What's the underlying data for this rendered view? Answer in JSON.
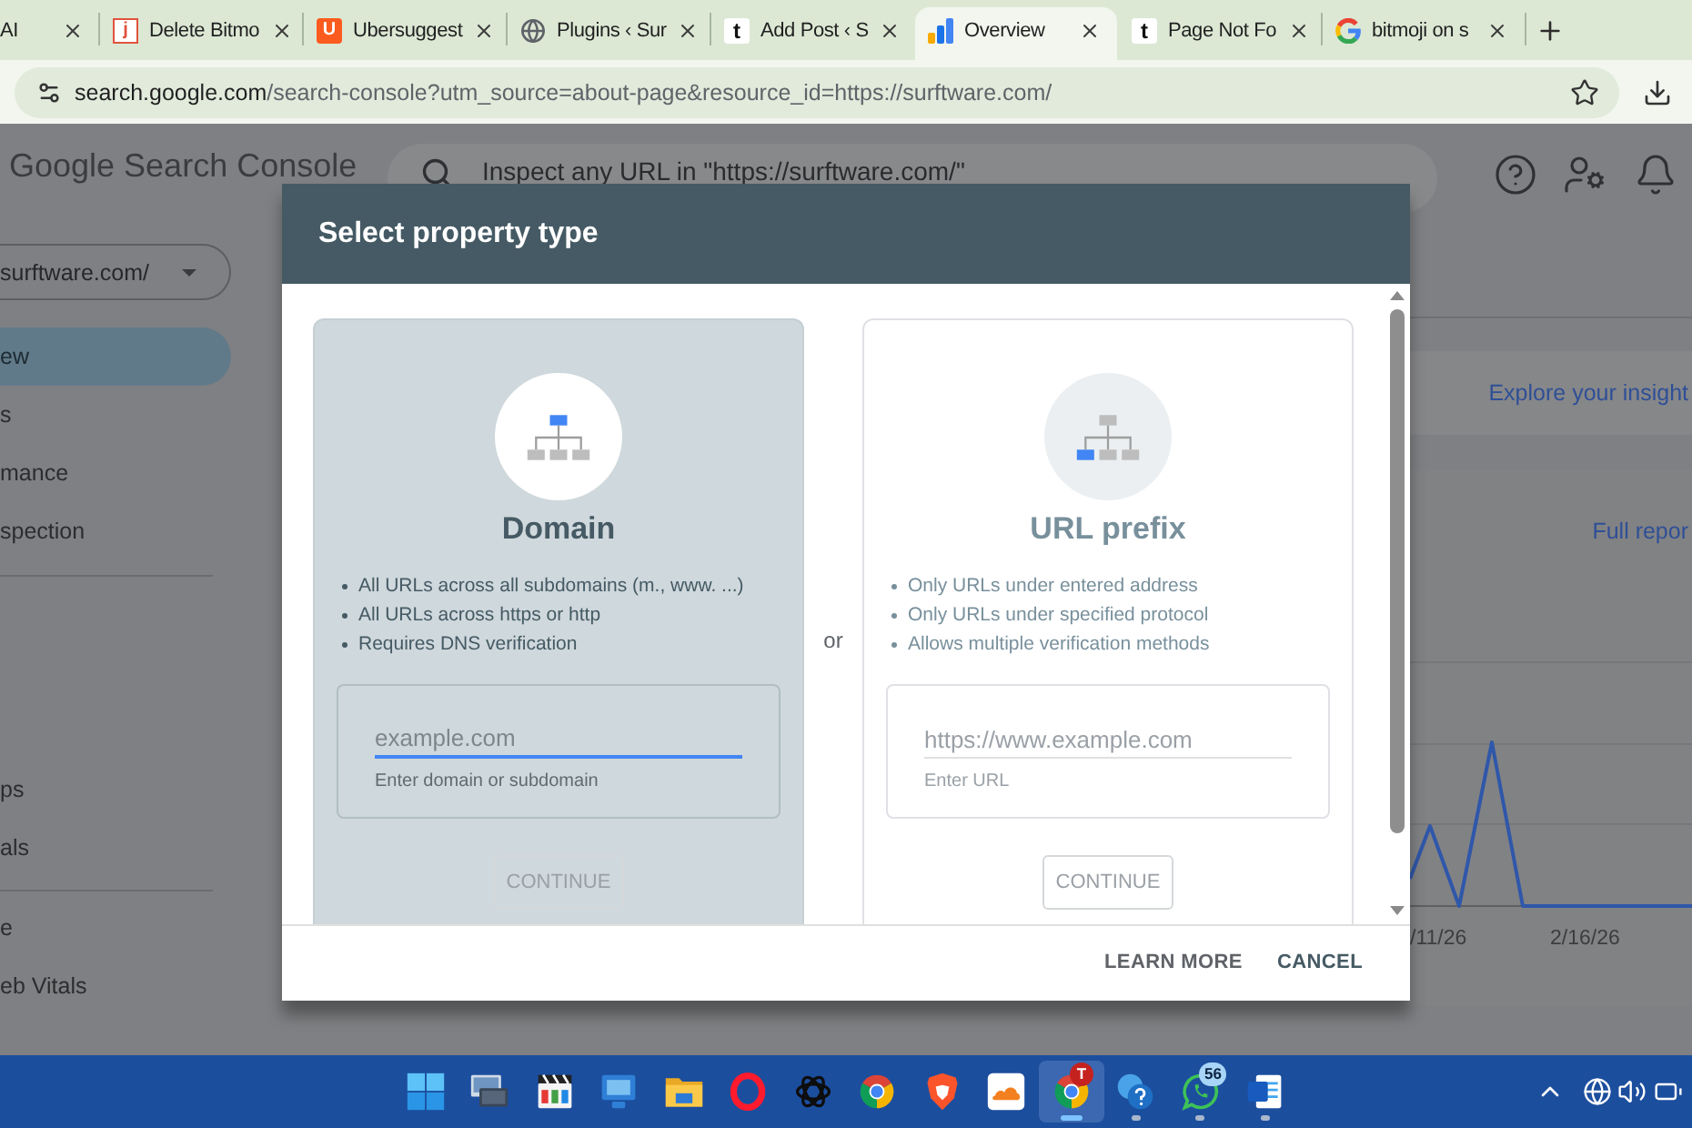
{
  "browser": {
    "tabs": [
      {
        "title": "AI",
        "selected": false
      },
      {
        "title": "Delete Bitmo",
        "selected": false,
        "favicon": {
          "kind": "outline-letter",
          "text": "j"
        }
      },
      {
        "title": "Ubersuggest",
        "selected": false,
        "favicon": {
          "kind": "filled-letter",
          "text": "U"
        }
      },
      {
        "title": "Plugins ‹ Sur",
        "selected": false,
        "favicon": {
          "kind": "globe"
        }
      },
      {
        "title": "Add Post ‹ S",
        "selected": false,
        "favicon": {
          "kind": "letter",
          "text": "t"
        }
      },
      {
        "title": "Overview",
        "selected": true,
        "favicon": {
          "kind": "analytics"
        }
      },
      {
        "title": "Page Not Fo",
        "selected": false,
        "favicon": {
          "kind": "letter",
          "text": "t"
        }
      },
      {
        "title": "bitmoji on s",
        "selected": false,
        "favicon": {
          "kind": "google"
        }
      }
    ],
    "address": {
      "host": "search.google.com",
      "path": "/search-console?utm_source=about-page&resource_id=https://surftware.com/"
    }
  },
  "header": {
    "product": "Google Search Console",
    "search": {
      "placeholder": "Inspect any URL in \"https://surftware.com/\""
    }
  },
  "sidebar": {
    "property": "surftware.com/",
    "groups": [
      {
        "items": [
          {
            "label": "ew",
            "selected": true
          },
          {
            "label": "s",
            "selected": false
          },
          {
            "label": "mance",
            "selected": false
          },
          {
            "label": "spection",
            "selected": false
          }
        ]
      },
      {
        "items": [
          {
            "label": "ps",
            "selected": false
          },
          {
            "label": "als",
            "selected": false
          }
        ]
      },
      {
        "items": [
          {
            "label": "e",
            "selected": false
          },
          {
            "label": "eb Vitals",
            "selected": false
          }
        ]
      }
    ]
  },
  "main": {
    "insights_link": "Explore your insight",
    "report_link": "Full repor",
    "chart": {
      "x_labels": [
        "/11/26",
        "2/16/26"
      ]
    }
  },
  "dialog": {
    "title": "Select property type",
    "options": [
      {
        "kind": "domain",
        "selected": true,
        "title": "Domain",
        "bullets": [
          "All URLs across all subdomains (m., www. ...)",
          "All URLs across https or http",
          "Requires DNS verification"
        ],
        "input": {
          "placeholder": "example.com",
          "helper": "Enter domain or subdomain"
        },
        "button": {
          "label": "CONTINUE",
          "disabled": true
        }
      },
      {
        "kind": "url-prefix",
        "selected": false,
        "title": "URL prefix",
        "bullets": [
          "Only URLs under entered address",
          "Only URLs under specified protocol",
          "Allows multiple verification methods"
        ],
        "input": {
          "placeholder": "https://www.example.com",
          "helper": "Enter URL"
        },
        "button": {
          "label": "CONTINUE",
          "disabled": true
        }
      }
    ],
    "separator": "or",
    "actions": [
      {
        "label": "LEARN MORE",
        "kind": "secondary"
      },
      {
        "label": "CANCEL",
        "kind": "primary"
      }
    ]
  },
  "taskbar": {
    "apps": [
      {
        "kind": "start",
        "running": false,
        "active": false
      },
      {
        "kind": "monitor",
        "running": false,
        "active": false
      },
      {
        "kind": "clapperboard",
        "running": false,
        "active": false
      },
      {
        "kind": "display",
        "running": false,
        "active": false
      },
      {
        "kind": "folder",
        "running": false,
        "active": false
      },
      {
        "kind": "ring",
        "running": false,
        "active": false
      },
      {
        "kind": "knot",
        "running": false,
        "active": false
      },
      {
        "kind": "browser",
        "running": false,
        "active": false
      },
      {
        "kind": "shield",
        "running": false,
        "active": false
      },
      {
        "kind": "cloud",
        "running": false,
        "active": false
      },
      {
        "kind": "browser",
        "running": true,
        "active": true,
        "badge": {
          "text": "T",
          "color": "#c5221f"
        }
      },
      {
        "kind": "help",
        "running": true,
        "active": false
      },
      {
        "kind": "chat",
        "running": true,
        "active": false,
        "badge": {
          "text": "56",
          "color": "#a8d4f7"
        }
      },
      {
        "kind": "document",
        "running": true,
        "active": false
      }
    ]
  }
}
